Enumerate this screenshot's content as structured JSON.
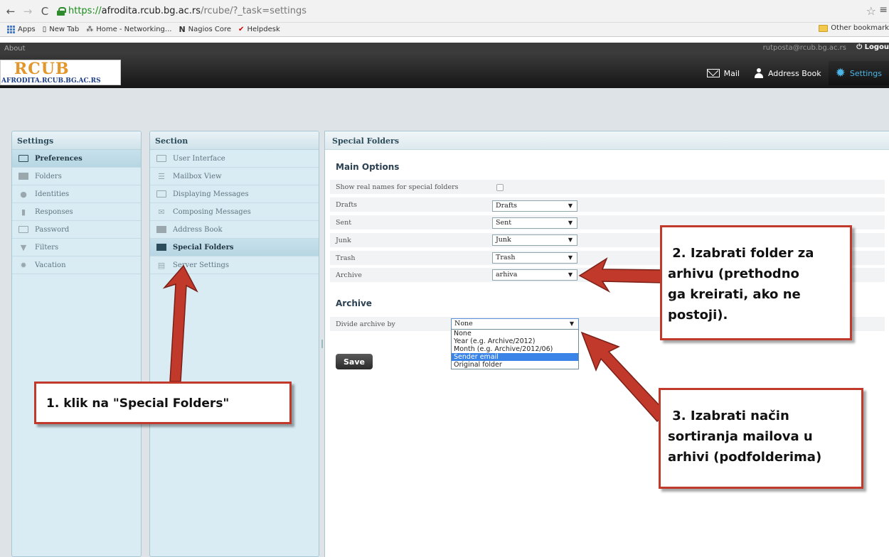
{
  "browser": {
    "url_scheme": "https://",
    "url_host": "afrodita.rcub.bg.ac.rs",
    "url_path": "/rcube/?_task=settings",
    "bookmarks": [
      "Apps",
      "New Tab",
      "Home - Networking...",
      "Nagios Core",
      "Helpdesk"
    ],
    "other_bookmarks": "Other bookmark"
  },
  "topline": {
    "about": "About",
    "user": "rutposta@rcub.bg.ac.rs",
    "logout": "Logou"
  },
  "logo": {
    "text": "RCUB",
    "subtitle": "AFRODITA.RCUB.BG.AC.RS"
  },
  "topnav": {
    "mail": "Mail",
    "address_book": "Address Book",
    "settings": "Settings"
  },
  "settings_panel": {
    "title": "Settings",
    "items": [
      {
        "label": "Preferences",
        "icon": "monitor-icon"
      },
      {
        "label": "Folders",
        "icon": "folder-icon"
      },
      {
        "label": "Identities",
        "icon": "person-icon"
      },
      {
        "label": "Responses",
        "icon": "document-icon"
      },
      {
        "label": "Password",
        "icon": "password-icon"
      },
      {
        "label": "Filters",
        "icon": "filter-icon"
      },
      {
        "label": "Vacation",
        "icon": "gear-icon"
      }
    ]
  },
  "section_panel": {
    "title": "Section",
    "items": [
      {
        "label": "User Interface"
      },
      {
        "label": "Mailbox View"
      },
      {
        "label": "Displaying Messages"
      },
      {
        "label": "Composing Messages"
      },
      {
        "label": "Address Book"
      },
      {
        "label": "Special Folders"
      },
      {
        "label": "Server Settings"
      }
    ]
  },
  "content": {
    "title": "Special Folders",
    "main_options_title": "Main Options",
    "rows": [
      {
        "label": "Show real names for special folders"
      },
      {
        "label": "Drafts",
        "value": "Drafts"
      },
      {
        "label": "Sent",
        "value": "Sent"
      },
      {
        "label": "Junk",
        "value": "Junk"
      },
      {
        "label": "Trash",
        "value": "Trash"
      },
      {
        "label": "Archive",
        "value": "arhiva"
      }
    ],
    "archive_title": "Archive",
    "divide_label": "Divide archive by",
    "divide_value": "None",
    "dropdown_options": [
      "None",
      "Year (e.g. Archive/2012)",
      "Month (e.g. Archive/2012/06)",
      "Sender email",
      "Original folder"
    ],
    "save": "Save"
  },
  "annotations": {
    "note1": "1. klik na \"Special Folders\"",
    "note2": [
      " 2. Izabrati folder za",
      "arhivu (prethodno",
      "ga kreirati, ako ne",
      "postoji)."
    ],
    "note3": [
      " 3. Izabrati način",
      "sortiranja mailova u",
      "arhivi (podfolderima)"
    ],
    "arrow_color": "#c0392b"
  }
}
